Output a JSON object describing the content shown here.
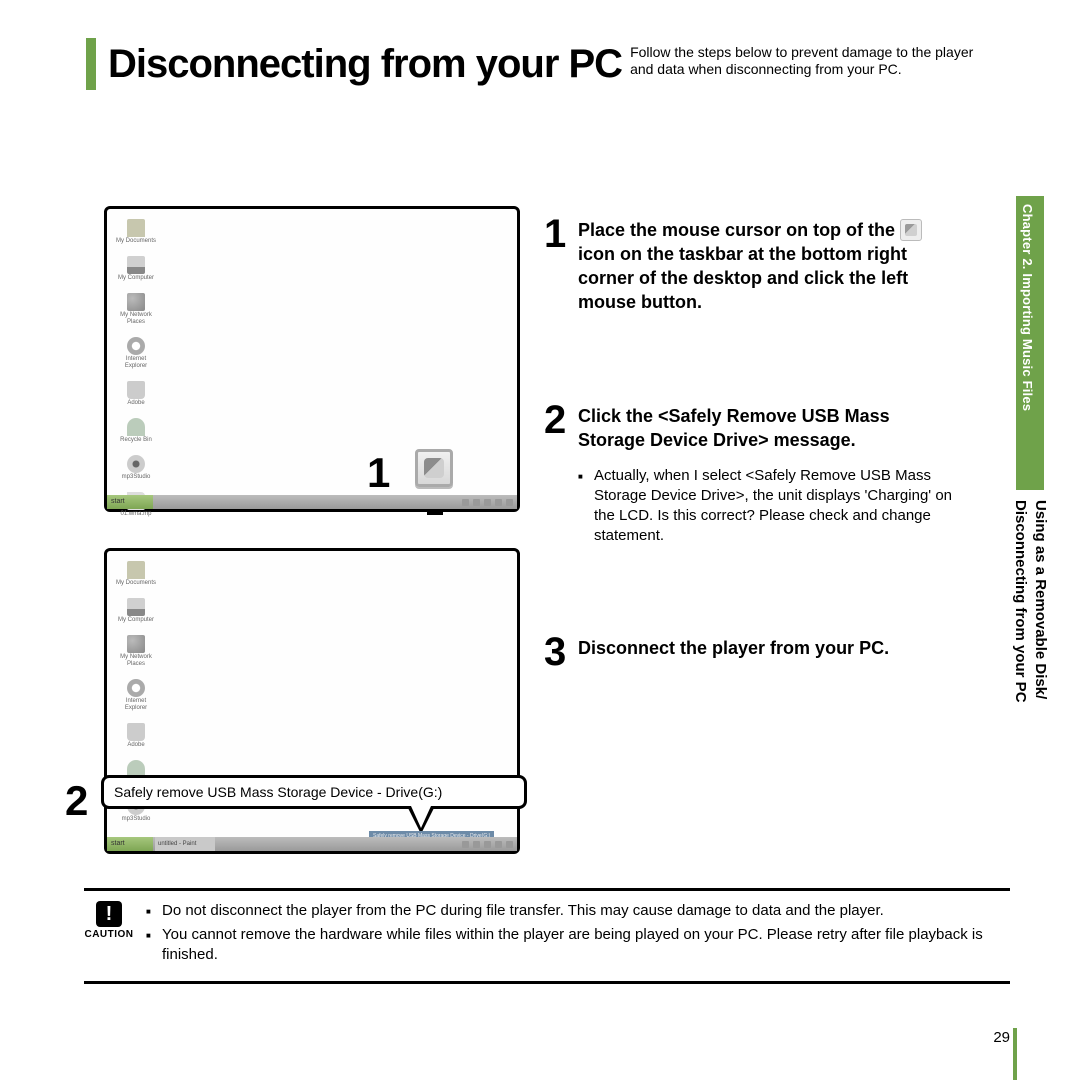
{
  "header": {
    "title": "Disconnecting from your PC",
    "subtitle": "Follow the steps below to prevent damage to the player and data when disconnecting from your PC."
  },
  "steps": [
    {
      "num": "1",
      "title_before": "Place the mouse cursor on top of the ",
      "title_after": " icon on the taskbar at the bottom right corner of the desktop and click the left mouse button."
    },
    {
      "num": "2",
      "title": "Click the <Safely Remove USB Mass Storage Device Drive> message.",
      "note": "Actually, when I select <Safely Remove USB Mass Storage Device Drive>, the unit displays 'Charging' on the LCD. Is this correct? Please check and change statement."
    },
    {
      "num": "3",
      "title": "Disconnect the player from your PC."
    }
  ],
  "screenshots": {
    "shot1_label": "1",
    "shot2_label": "2",
    "popup_text": "Safely remove USB Mass Storage Device - Drive(G:)",
    "taskbar_start": "start",
    "task_open": "untitled - Paint",
    "tooltip_tiny": "Safely remove USB Mass Storage Device - Drive(G:)",
    "desktop_icons": [
      "My Documents",
      "My Computer",
      "My Network Places",
      "Internet Explorer",
      "Adobe",
      "Recycle Bin",
      "mp3Studio",
      "01.wma.mp"
    ]
  },
  "caution": {
    "label": "CAUTION",
    "glyph": "!",
    "items": [
      "Do not disconnect the player from the PC during file transfer. This may cause damage to data and the player.",
      "You cannot remove the hardware while files within the player are being played on your PC. Please retry after file playback is finished."
    ]
  },
  "sidebar": {
    "chapter": "Chapter 2. Importing Music Files",
    "section_line1": "Using as a Removable Disk/",
    "section_line2": "Disconnecting from your PC"
  },
  "page_number": "29"
}
